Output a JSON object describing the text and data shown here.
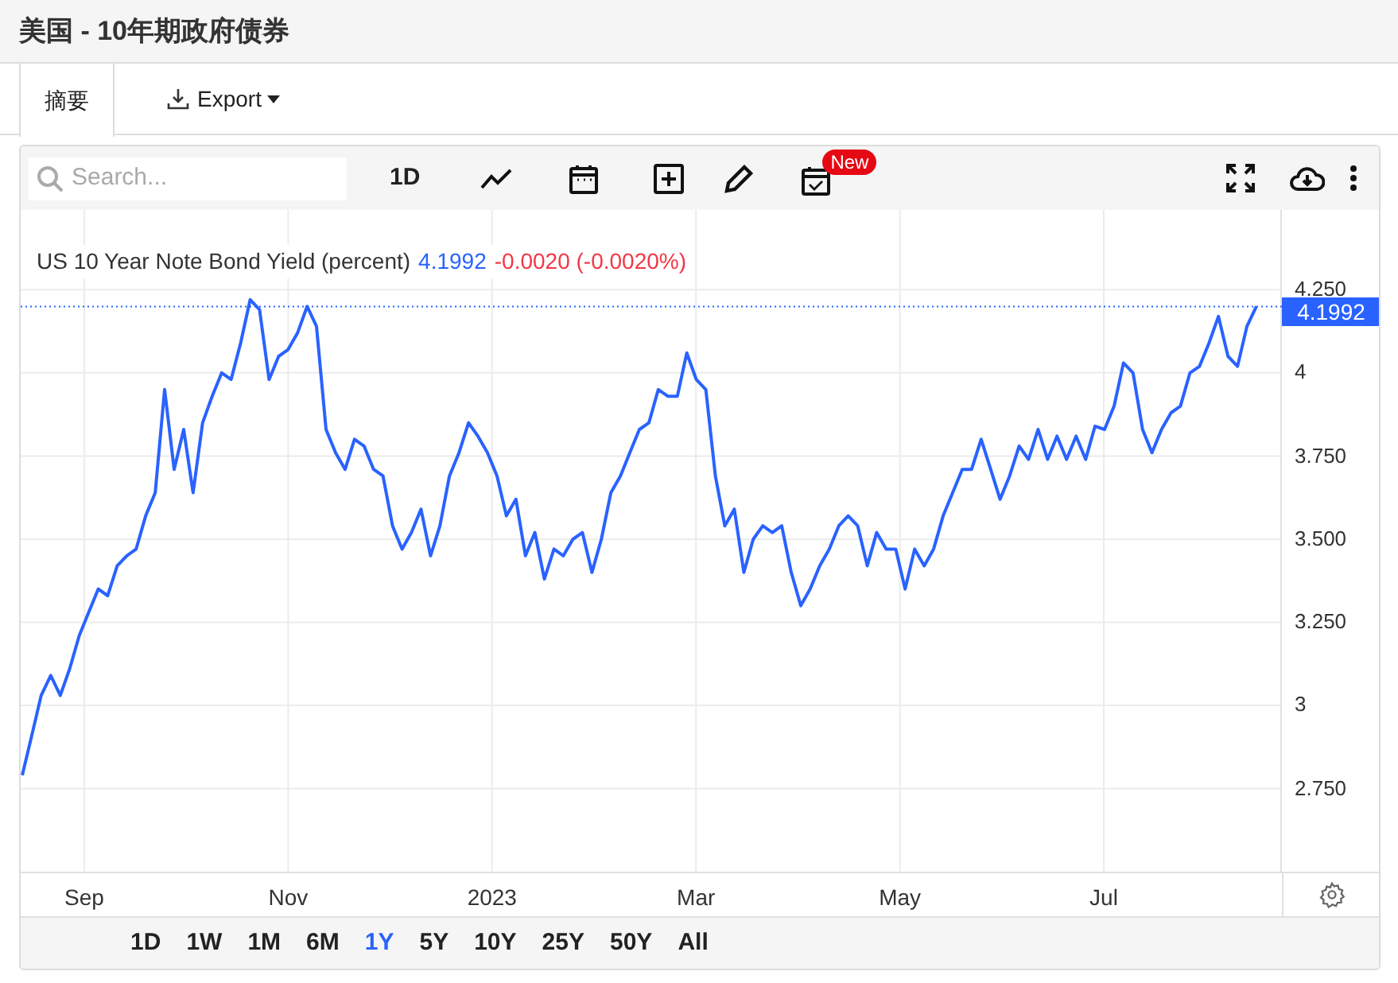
{
  "header": {
    "title": "美国 - 10年期政府债券"
  },
  "tabs": [
    {
      "label": "摘要",
      "selected": true
    }
  ],
  "export_button": {
    "label": "Export"
  },
  "chart_toolbar": {
    "search": {
      "placeholder": "Search..."
    },
    "interval": "1D",
    "badge": "New"
  },
  "chart": {
    "legend": {
      "name": "US 10 Year Note Bond Yield (percent)",
      "value": "4.1992",
      "change": "-0.0020 (-0.0020%)"
    },
    "x_axis_labels": [
      "Sep",
      "Nov",
      "2023",
      "Mar",
      "May",
      "Jul"
    ],
    "chart_data": {
      "type": "line",
      "series": [
        {
          "color": "#2962ff",
          "values": [
            2.79,
            2.91,
            3.03,
            3.09,
            3.03,
            3.11,
            3.21,
            3.28,
            3.35,
            3.33,
            3.42,
            3.45,
            3.47,
            3.57,
            3.64,
            3.95,
            3.71,
            3.83,
            3.64,
            3.85,
            3.93,
            4.0,
            3.98,
            4.09,
            4.22,
            4.19,
            3.98,
            4.05,
            4.07,
            4.12,
            4.2,
            4.14,
            3.83,
            3.76,
            3.71,
            3.8,
            3.78,
            3.71,
            3.69,
            3.54,
            3.47,
            3.52,
            3.59,
            3.45,
            3.54,
            3.69,
            3.76,
            3.85,
            3.81,
            3.76,
            3.69,
            3.57,
            3.62,
            3.45,
            3.52,
            3.38,
            3.47,
            3.45,
            3.5,
            3.52,
            3.4,
            3.5,
            3.64,
            3.69,
            3.76,
            3.83,
            3.85,
            3.95,
            3.93,
            3.93,
            4.06,
            3.98,
            3.95,
            3.69,
            3.54,
            3.59,
            3.4,
            3.5,
            3.54,
            3.52,
            3.54,
            3.4,
            3.3,
            3.35,
            3.42,
            3.47,
            3.54,
            3.57,
            3.54,
            3.42,
            3.52,
            3.47,
            3.47,
            3.35,
            3.47,
            3.42,
            3.47,
            3.57,
            3.64,
            3.71,
            3.71,
            3.8,
            3.71,
            3.62,
            3.69,
            3.78,
            3.74,
            3.83,
            3.74,
            3.81,
            3.74,
            3.81,
            3.74,
            3.84,
            3.83,
            3.9,
            4.03,
            4.0,
            3.83,
            3.76,
            3.83,
            3.88,
            3.9,
            4.0,
            4.02,
            4.09,
            4.17,
            4.05,
            4.02,
            4.14,
            4.2
          ]
        }
      ],
      "grid": true,
      "ref_lines": [
        {
          "axis": "y",
          "value": 4.1992,
          "label": "4.1992",
          "color": "#2962ff"
        }
      ],
      "yticks": [
        {
          "value": 2.75,
          "label": "2.750"
        },
        {
          "value": 3,
          "label": "3"
        },
        {
          "value": 3.25,
          "label": "3.250"
        },
        {
          "value": 3.5,
          "label": "3.500"
        },
        {
          "value": 3.75,
          "label": "3.750"
        },
        {
          "value": 4,
          "label": "4"
        },
        {
          "value": 4.25,
          "label": "4.250"
        }
      ],
      "ylim": [
        2.5,
        4.49
      ]
    }
  },
  "ranges": [
    {
      "label": "1D",
      "selected": false
    },
    {
      "label": "1W",
      "selected": false
    },
    {
      "label": "1M",
      "selected": false
    },
    {
      "label": "6M",
      "selected": false
    },
    {
      "label": "1Y",
      "selected": true
    },
    {
      "label": "5Y",
      "selected": false
    },
    {
      "label": "10Y",
      "selected": false
    },
    {
      "label": "25Y",
      "selected": false
    },
    {
      "label": "50Y",
      "selected": false
    },
    {
      "label": "All",
      "selected": false
    }
  ]
}
